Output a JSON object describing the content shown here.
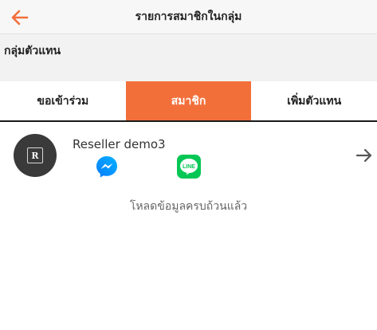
{
  "header": {
    "title": "รายการสมาชิกในกลุ่ม",
    "back_icon": "arrow-left-icon"
  },
  "group": {
    "label": "กลุ่มตัวแทน"
  },
  "tabs": [
    {
      "label": "ขอเข้าร่วม",
      "active": false
    },
    {
      "label": "สมาชิก",
      "active": true
    },
    {
      "label": "เพิ่มตัวแทน",
      "active": false
    }
  ],
  "members": [
    {
      "name": "Reseller demo3",
      "avatar_letter": "R"
    }
  ],
  "status": {
    "text": "โหลดข้อมูลครบถ้วนแล้ว"
  },
  "colors": {
    "accent": "#f36f3a",
    "messenger": "#0a7cff",
    "line": "#06c755"
  }
}
